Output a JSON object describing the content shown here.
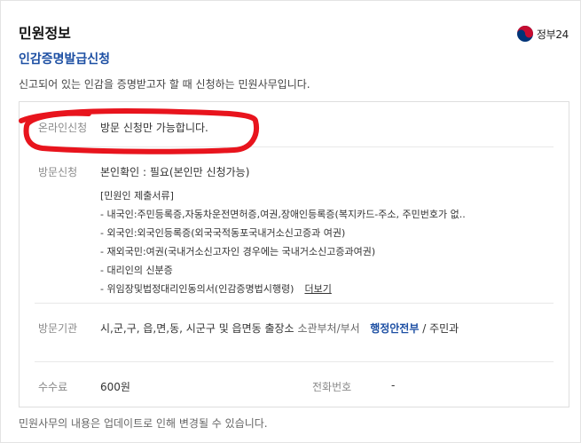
{
  "header": {
    "section_title": "민원정보",
    "logo_text": "정부24",
    "logo_colors": {
      "red": "#c60c30",
      "blue": "#003478"
    }
  },
  "service": {
    "title": "인감증명발급신청",
    "description": "신고되어 있는 인감을 증명받고자 할 때 신청하는 민원사무입니다."
  },
  "online": {
    "label": "온라인신청",
    "value": "방문 신청만 가능합니다."
  },
  "visit": {
    "label": "방문신청",
    "identity": "본인확인 : 필요(본인만 신청가능)",
    "documents_title": "[민원인 제출서류]",
    "documents": [
      "- 내국인:주민등록증,자동차운전면허증,여권,장애인등록증(복지카드-주소, 주민번호가 없..",
      "- 외국인:외국인등록증(외국국적동포국내거소신고증과 여권)",
      "- 재외국민:여권(국내거소신고자인 경우에는 국내거소신고증과여권)",
      "- 대리인의 신분증",
      "- 위임장및법정대리인동의서(인감증명법시행령)"
    ],
    "more_label": "더보기"
  },
  "agency": {
    "label": "방문기관",
    "value": "시,군,구, 읍,면,동, 시군구 및 읍면동 출장소",
    "dept_label": "소관부처/부서",
    "dept_ministry": "행정안전부",
    "dept_separator": "/",
    "dept_division": "주민과"
  },
  "fee": {
    "label": "수수료",
    "value": "600원",
    "phone_label": "전화번호",
    "phone_value": "-"
  },
  "footer": {
    "note": "민원사무의 내용은 업데이트로 인해 변경될 수 있습니다."
  },
  "annotation": {
    "color": "#e8141d"
  }
}
